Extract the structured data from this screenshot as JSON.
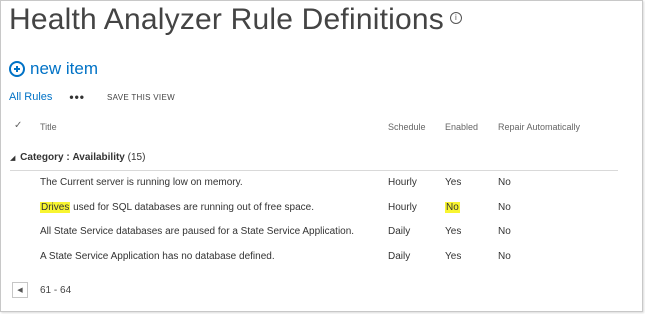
{
  "page": {
    "title": "Health Analyzer Rule Definitions",
    "info_icon": "ⓘ"
  },
  "toolbar": {
    "new_item_label": "new item",
    "view_label": "All Rules",
    "more_label": "•••",
    "save_view_label": "SAVE THIS VIEW"
  },
  "columns": {
    "check": "✓",
    "title": "Title",
    "schedule": "Schedule",
    "enabled": "Enabled",
    "repair": "Repair Automatically"
  },
  "group": {
    "label": "Category",
    "separator": ":",
    "value": "Availability",
    "count": "(15)"
  },
  "rows": [
    {
      "title": "The Current server is running low on memory.",
      "schedule": "Hourly",
      "enabled": "Yes",
      "repair": "No"
    },
    {
      "title_highlight": "Drives",
      "title_rest": " used for SQL databases are running out of free space.",
      "schedule": "Hourly",
      "enabled": "No",
      "repair": "No"
    },
    {
      "title": "All State Service databases are paused for a State Service Application.",
      "schedule": "Daily",
      "enabled": "Yes",
      "repair": "No"
    },
    {
      "title": "A State Service Application has no database defined.",
      "schedule": "Daily",
      "enabled": "Yes",
      "repair": "No"
    }
  ],
  "pager": {
    "prev_icon": "◀",
    "range": "61 - 64"
  },
  "colors": {
    "link": "#0072c6",
    "highlight": "#f8f531"
  }
}
